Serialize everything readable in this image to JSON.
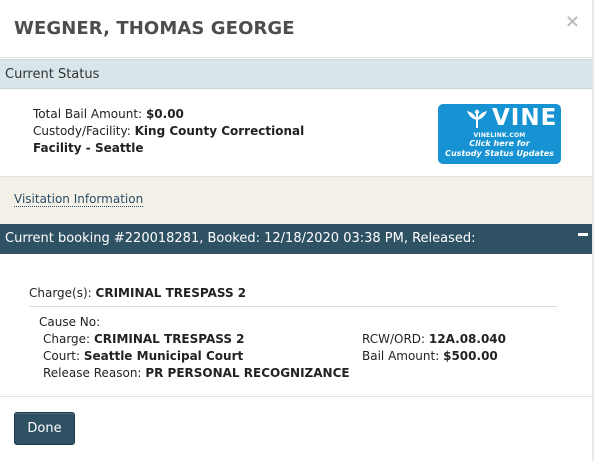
{
  "dialog": {
    "title": "WEGNER, THOMAS GEORGE",
    "close_glyph": "×"
  },
  "status": {
    "heading": "Current Status",
    "bail_label": "Total Bail Amount:",
    "bail_value": "$0.00",
    "facility_label": "Custody/Facility:",
    "facility_value": "King County Correctional Facility - Seattle"
  },
  "vine": {
    "logo_text": "VINE",
    "url_text": "VINELINK.COM",
    "cta_line1": "Click here for",
    "cta_line2": "Custody Status Updates",
    "color": "#1793d3"
  },
  "visitation": {
    "link_label": "Visitation Information"
  },
  "booking": {
    "header": "Current booking #220018281, Booked: 12/18/2020 03:38 PM, Released:",
    "collapse_icon": "minus-icon",
    "charges_label": "Charge(s):",
    "charges_value": "CRIMINAL TRESPASS 2",
    "cause_label": "Cause No:",
    "cause_value": "",
    "charge_label": "Charge:",
    "charge_value": "CRIMINAL TRESPASS 2",
    "court_label": "Court:",
    "court_value": "Seattle Municipal Court",
    "release_label": "Release Reason:",
    "release_value": "PR PERSONAL RECOGNIZANCE",
    "rcw_label": "RCW/ORD:",
    "rcw_value": "12A.08.040",
    "bail_label": "Bail Amount:",
    "bail_value": "$500.00"
  },
  "footer": {
    "done_label": "Done"
  },
  "colors": {
    "header_dark": "#2f5164",
    "status_bar": "#d9e6e9",
    "visit_bg": "#f3f1e7"
  }
}
